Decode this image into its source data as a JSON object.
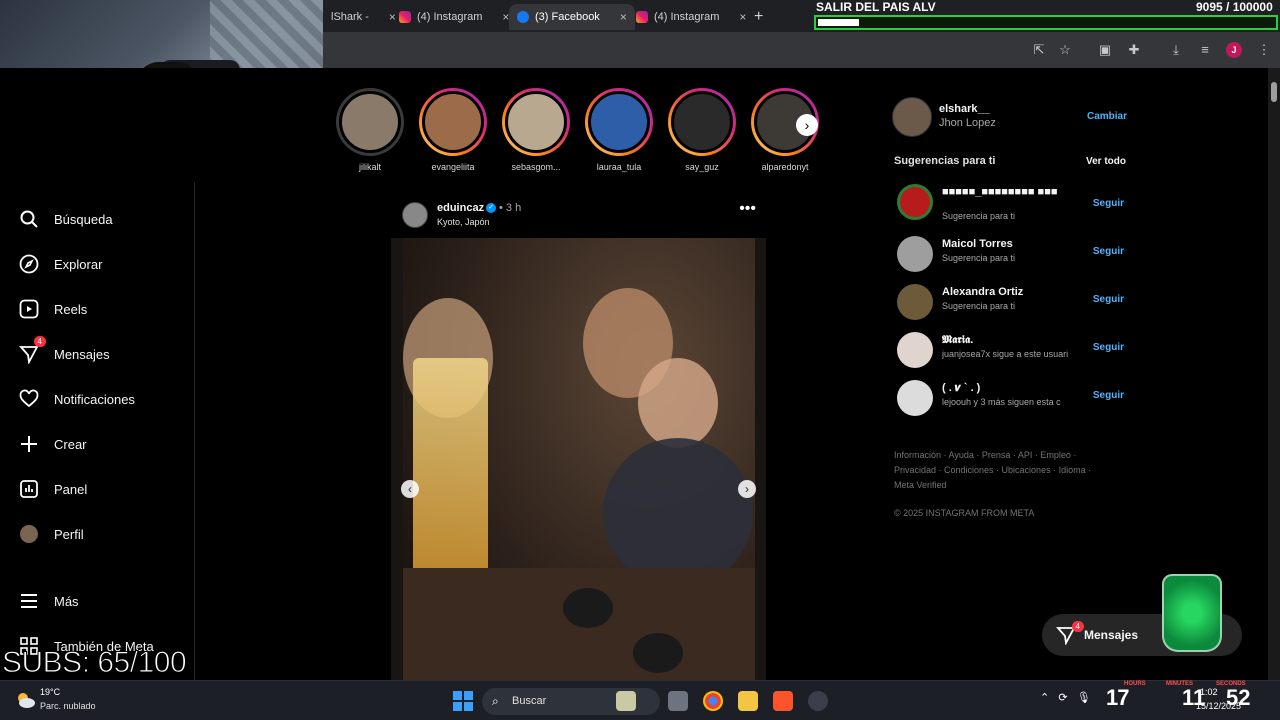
{
  "browser": {
    "tabs": [
      {
        "label": "lShark -",
        "icon": "none"
      },
      {
        "label": "(4) Instagram",
        "icon": "instagram"
      },
      {
        "label": "(3) Facebook",
        "icon": "facebook"
      },
      {
        "label": "(4) Instagram",
        "icon": "instagram"
      }
    ],
    "new_tab": "+",
    "close": "×",
    "profile_initial": "J"
  },
  "overlay": {
    "goal_title": "SALIR DEL PAIS ALV",
    "goal_count": "9095  / 100000",
    "goal_progress": 0.09095,
    "goal_color": "#2ecc40",
    "subs": "SUBS: 65/100"
  },
  "nav": {
    "items": [
      {
        "label": "Búsqueda",
        "icon": "search-icon"
      },
      {
        "label": "Explorar",
        "icon": "compass-icon"
      },
      {
        "label": "Reels",
        "icon": "reels-icon"
      },
      {
        "label": "Mensajes",
        "icon": "messenger-icon",
        "badge": "4"
      },
      {
        "label": "Notificaciones",
        "icon": "heart-icon"
      },
      {
        "label": "Crear",
        "icon": "plus-icon"
      },
      {
        "label": "Panel",
        "icon": "chart-icon"
      },
      {
        "label": "Perfil",
        "icon": "avatar"
      },
      {
        "label": "Más",
        "icon": "menu-icon"
      },
      {
        "label": "También de Meta",
        "icon": "grid-icon"
      }
    ]
  },
  "stories": [
    {
      "name": "jilikalt",
      "seen": true
    },
    {
      "name": "evangeliita",
      "seen": false
    },
    {
      "name": "sebasgom...",
      "seen": false
    },
    {
      "name": "lauraa_tula",
      "seen": false
    },
    {
      "name": "say_guz",
      "seen": false
    },
    {
      "name": "alparedonyt",
      "seen": false
    }
  ],
  "post": {
    "user": "eduincaz",
    "time": "• 3 h",
    "location": "Kyoto, Japón",
    "more": "•••"
  },
  "sidebar_right": {
    "me_user": "elshark__",
    "me_name": "Jhon Lopez",
    "switch": "Cambiar",
    "suggestions_title": "Sugerencias para ti",
    "see_all": "Ver todo",
    "suggestions": [
      {
        "name": "■■■■■_■■■■■■■■ ■■■",
        "sub": "Sugerencia para ti",
        "follow": "Seguir",
        "color": "#b71c1c"
      },
      {
        "name": "Maicol Torres",
        "sub": "Sugerencia para ti",
        "follow": "Seguir",
        "color": "#9e9e9e"
      },
      {
        "name": "Alexandra Ortiz",
        "sub": "Sugerencia para ti",
        "follow": "Seguir",
        "color": "#6d5a3a"
      },
      {
        "name": "𝕸𝖆𝖗𝖎𝖆.",
        "sub": "juanjosea7x sigue a este usuari",
        "follow": "Seguir",
        "color": "#e0d4cf"
      },
      {
        "name": "( . 𝒗 ` . )",
        "sub": "lejoouh y 3 más siguen esta c",
        "follow": "Seguir",
        "color": "#dcdcdc"
      }
    ],
    "footer": "Información · Ayuda · Prensa · API · Empleo · Privacidad · Condiciones · Ubicaciones · Idioma · Meta Verified",
    "copyright": "© 2025 INSTAGRAM FROM META"
  },
  "messages_pill": {
    "label": "Mensajes",
    "badge": "4"
  },
  "taskbar": {
    "temp": "19°C",
    "condition": "Parc. nublado",
    "search": "Buscar",
    "date": "15/12/2025",
    "time": "1:02",
    "big_hours": "17",
    "big_minutes": "11",
    "big_seconds": "52",
    "label_hours": "HOURS",
    "label_minutes": "MINUTES",
    "label_seconds": "SECONDS"
  }
}
